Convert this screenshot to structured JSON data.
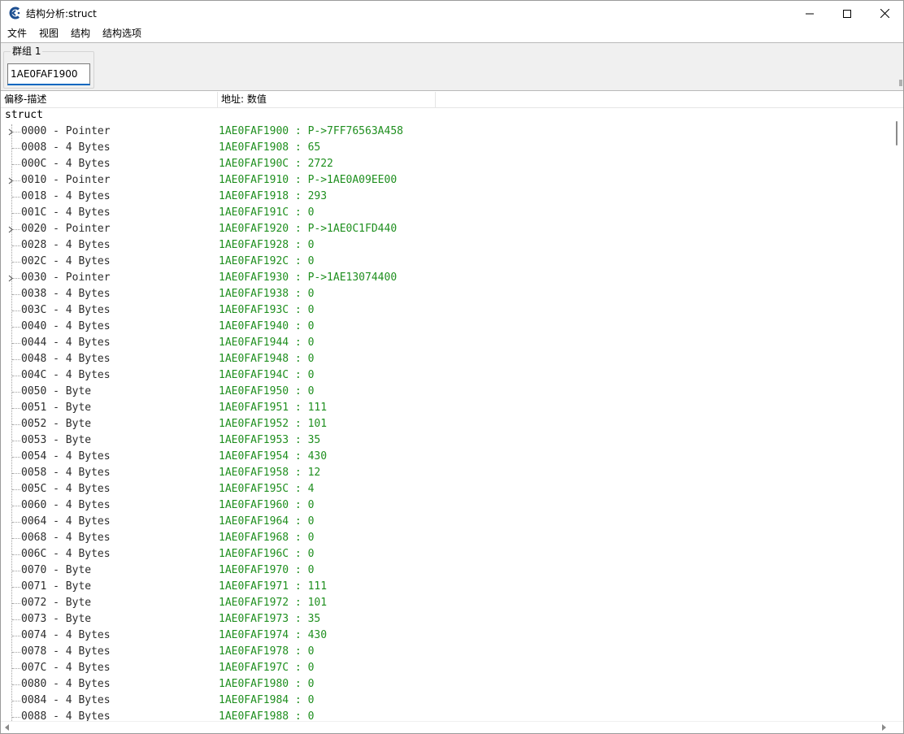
{
  "window": {
    "title": "结构分析:struct",
    "icons": {
      "app": "cheat-engine-icon",
      "minimize": "minimize-icon",
      "maximize": "maximize-icon",
      "close": "close-icon"
    }
  },
  "menu": [
    "文件",
    "视图",
    "结构",
    "结构选项"
  ],
  "group": {
    "label": "群组 1",
    "address": "1AE0FAF1900"
  },
  "columns": {
    "offset_desc": "偏移-描述",
    "address_value": "地址: 数值"
  },
  "tree": {
    "root": "struct",
    "rows": [
      {
        "offset": "0000 - Pointer",
        "value": "1AE0FAF1900 : P->7FF76563A458",
        "expandable": true
      },
      {
        "offset": "0008 - 4 Bytes",
        "value": "1AE0FAF1908 : 65",
        "expandable": false
      },
      {
        "offset": "000C - 4 Bytes",
        "value": "1AE0FAF190C : 2722",
        "expandable": false
      },
      {
        "offset": "0010 - Pointer",
        "value": "1AE0FAF1910 : P->1AE0A09EE00",
        "expandable": true
      },
      {
        "offset": "0018 - 4 Bytes",
        "value": "1AE0FAF1918 : 293",
        "expandable": false
      },
      {
        "offset": "001C - 4 Bytes",
        "value": "1AE0FAF191C : 0",
        "expandable": false
      },
      {
        "offset": "0020 - Pointer",
        "value": "1AE0FAF1920 : P->1AE0C1FD440",
        "expandable": true
      },
      {
        "offset": "0028 - 4 Bytes",
        "value": "1AE0FAF1928 : 0",
        "expandable": false
      },
      {
        "offset": "002C - 4 Bytes",
        "value": "1AE0FAF192C : 0",
        "expandable": false
      },
      {
        "offset": "0030 - Pointer",
        "value": "1AE0FAF1930 : P->1AE13074400",
        "expandable": true
      },
      {
        "offset": "0038 - 4 Bytes",
        "value": "1AE0FAF1938 : 0",
        "expandable": false
      },
      {
        "offset": "003C - 4 Bytes",
        "value": "1AE0FAF193C : 0",
        "expandable": false
      },
      {
        "offset": "0040 - 4 Bytes",
        "value": "1AE0FAF1940 : 0",
        "expandable": false
      },
      {
        "offset": "0044 - 4 Bytes",
        "value": "1AE0FAF1944 : 0",
        "expandable": false
      },
      {
        "offset": "0048 - 4 Bytes",
        "value": "1AE0FAF1948 : 0",
        "expandable": false
      },
      {
        "offset": "004C - 4 Bytes",
        "value": "1AE0FAF194C : 0",
        "expandable": false
      },
      {
        "offset": "0050 - Byte",
        "value": "1AE0FAF1950 : 0",
        "expandable": false
      },
      {
        "offset": "0051 - Byte",
        "value": "1AE0FAF1951 : 111",
        "expandable": false
      },
      {
        "offset": "0052 - Byte",
        "value": "1AE0FAF1952 : 101",
        "expandable": false
      },
      {
        "offset": "0053 - Byte",
        "value": "1AE0FAF1953 : 35",
        "expandable": false
      },
      {
        "offset": "0054 - 4 Bytes",
        "value": "1AE0FAF1954 : 430",
        "expandable": false
      },
      {
        "offset": "0058 - 4 Bytes",
        "value": "1AE0FAF1958 : 12",
        "expandable": false
      },
      {
        "offset": "005C - 4 Bytes",
        "value": "1AE0FAF195C : 4",
        "expandable": false
      },
      {
        "offset": "0060 - 4 Bytes",
        "value": "1AE0FAF1960 : 0",
        "expandable": false
      },
      {
        "offset": "0064 - 4 Bytes",
        "value": "1AE0FAF1964 : 0",
        "expandable": false
      },
      {
        "offset": "0068 - 4 Bytes",
        "value": "1AE0FAF1968 : 0",
        "expandable": false
      },
      {
        "offset": "006C - 4 Bytes",
        "value": "1AE0FAF196C : 0",
        "expandable": false
      },
      {
        "offset": "0070 - Byte",
        "value": "1AE0FAF1970 : 0",
        "expandable": false
      },
      {
        "offset": "0071 - Byte",
        "value": "1AE0FAF1971 : 111",
        "expandable": false
      },
      {
        "offset": "0072 - Byte",
        "value": "1AE0FAF1972 : 101",
        "expandable": false
      },
      {
        "offset": "0073 - Byte",
        "value": "1AE0FAF1973 : 35",
        "expandable": false
      },
      {
        "offset": "0074 - 4 Bytes",
        "value": "1AE0FAF1974 : 430",
        "expandable": false
      },
      {
        "offset": "0078 - 4 Bytes",
        "value": "1AE0FAF1978 : 0",
        "expandable": false
      },
      {
        "offset": "007C - 4 Bytes",
        "value": "1AE0FAF197C : 0",
        "expandable": false
      },
      {
        "offset": "0080 - 4 Bytes",
        "value": "1AE0FAF1980 : 0",
        "expandable": false
      },
      {
        "offset": "0084 - 4 Bytes",
        "value": "1AE0FAF1984 : 0",
        "expandable": false
      },
      {
        "offset": "0088 - 4 Bytes",
        "value": "1AE0FAF1988 : 0",
        "expandable": false
      }
    ]
  },
  "colors": {
    "value_text": "#1f8f1f",
    "offset_text": "#2c2c2c",
    "panel_bg": "#f0f0f0",
    "accent": "#0067c0"
  }
}
